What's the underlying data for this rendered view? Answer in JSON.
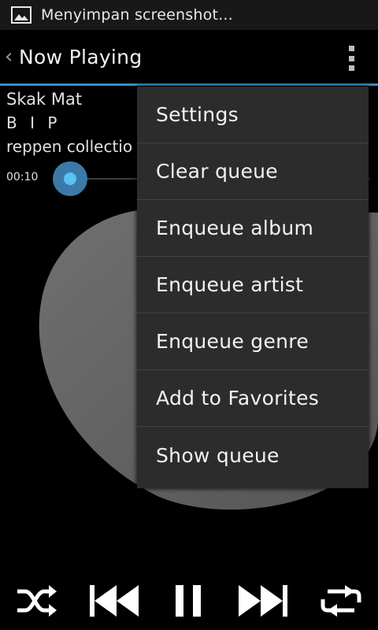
{
  "status_bar": {
    "text": "Menyimpan screenshot...",
    "icon": "image-icon"
  },
  "action_bar": {
    "back_icon": "back-chevron-icon",
    "title": "Now Playing",
    "overflow_icon": "overflow-menu-icon"
  },
  "track": {
    "title": "Skak Mat",
    "artist": "B I P",
    "album": "reppen collectio",
    "elapsed": "00:10"
  },
  "menu": {
    "items": [
      "Settings",
      "Clear queue",
      "Enqueue album",
      "Enqueue artist",
      "Enqueue genre",
      "Add to Favorites",
      "Show queue"
    ]
  },
  "controls": {
    "shuffle_icon": "shuffle-icon",
    "previous_icon": "previous-icon",
    "pause_icon": "pause-icon",
    "next_icon": "next-icon",
    "repeat_icon": "repeat-icon"
  },
  "colors": {
    "accent": "#3a8ec4",
    "seek_knob": "#58c2f0",
    "menu_bg": "#2c2c2c"
  }
}
